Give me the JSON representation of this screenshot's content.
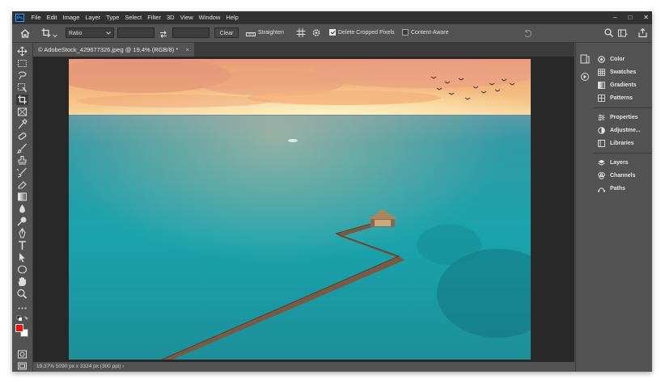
{
  "menubar": {
    "logo": "Ps",
    "items": [
      "File",
      "Edit",
      "Image",
      "Layer",
      "Type",
      "Select",
      "Filter",
      "3D",
      "View",
      "Window",
      "Help"
    ],
    "controls": [
      "–",
      "□",
      "✕"
    ]
  },
  "options": {
    "ratio_value": "Ratio",
    "clear_label": "Clear",
    "straighten_label": "Straighten",
    "delete_cropped_label": "Delete Cropped Pixels",
    "delete_cropped_checked": true,
    "content_aware_label": "Content-Aware",
    "content_aware_checked": false
  },
  "document": {
    "tab_title": "© AdobeStock_429677326.jpeg @ 19,4% (RGB/8) *",
    "close": "×"
  },
  "status": {
    "text": "19,37%    5090 px x 3324 px (300 ppi)    ›"
  },
  "panels": {
    "group1": [
      "Color",
      "Swatches",
      "Gradients",
      "Patterns"
    ],
    "group2": [
      "Properties",
      "Adjustme...",
      "Libraries"
    ],
    "group3": [
      "Layers",
      "Channels",
      "Paths"
    ]
  },
  "colors": {
    "foreground": "#e8170e",
    "background": "#ffffff"
  }
}
